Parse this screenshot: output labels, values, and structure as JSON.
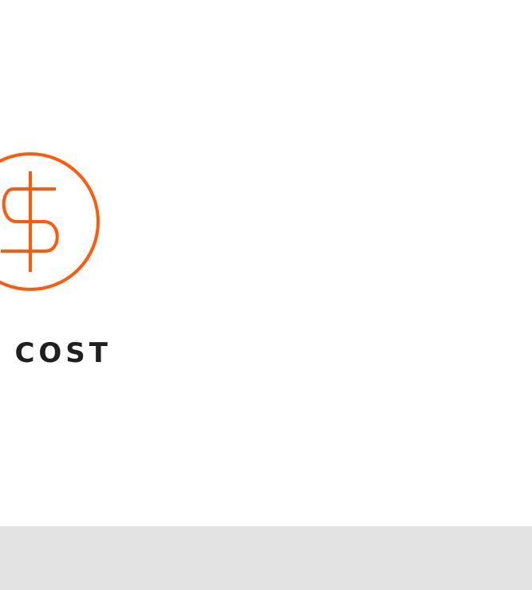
{
  "feature": {
    "label": "COST",
    "icon": "dollar-icon"
  },
  "colors": {
    "accent": "#FF5A0A",
    "text": "#1F1F1F",
    "background": "#FFFFFF",
    "footer": "#E2E3E2"
  }
}
